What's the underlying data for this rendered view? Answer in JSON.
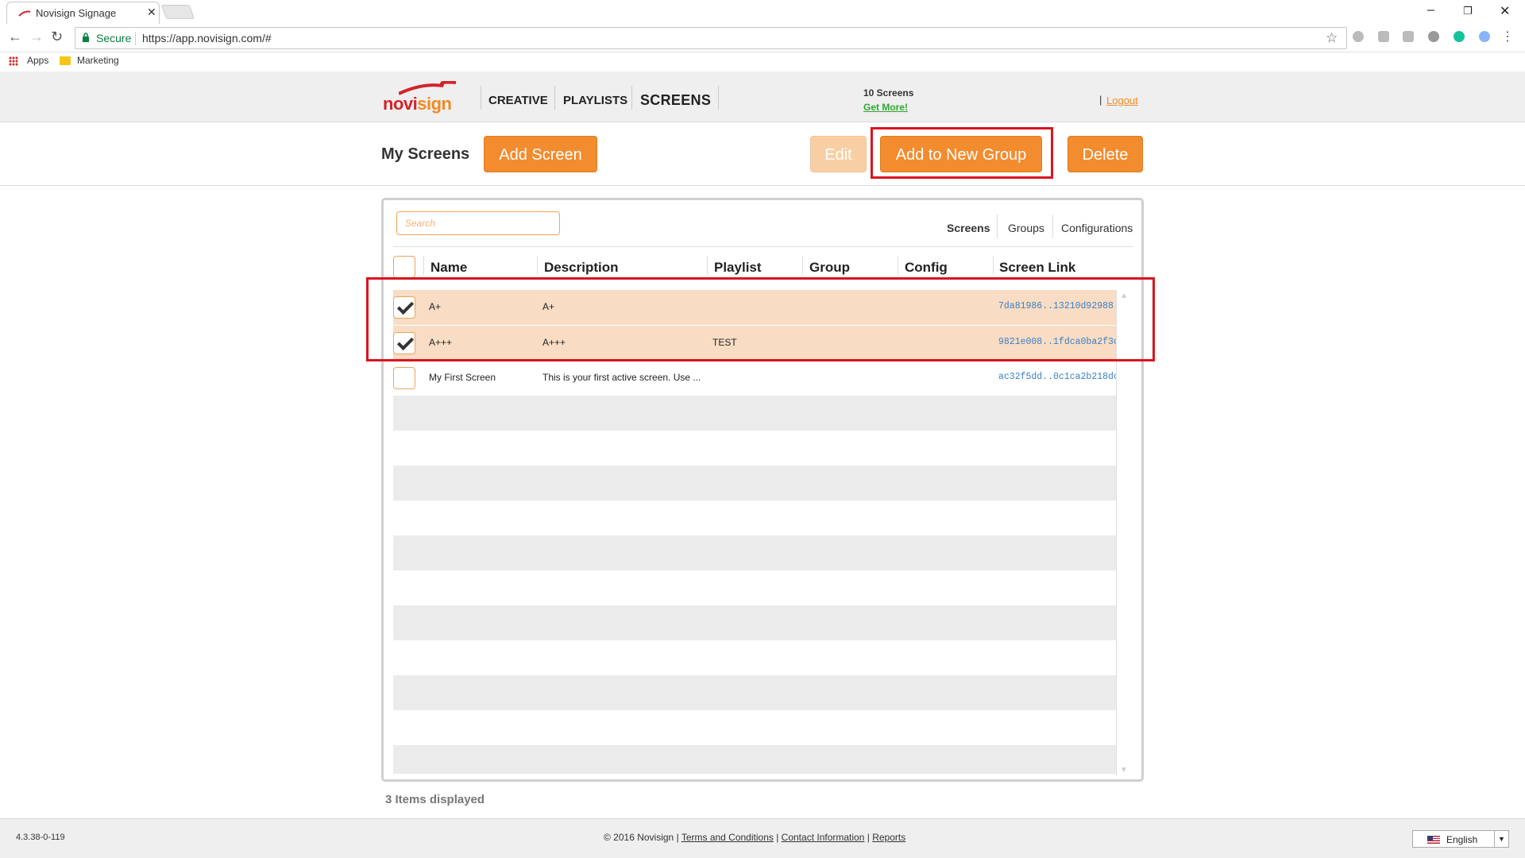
{
  "browser": {
    "tab_title": "Novisign Signage",
    "tab_close": "✕",
    "secure_label": "Secure",
    "url": "https://app.novisign.com/#",
    "bookmarks": [
      "Apps",
      "Marketing"
    ]
  },
  "header": {
    "logo_a": "novi",
    "logo_b": "sign",
    "nav": [
      "CREATIVE",
      "PLAYLISTS",
      "SCREENS"
    ],
    "screens_count": "10 Screens",
    "get_more": "Get More!",
    "logout_sep": "|",
    "logout": "Logout"
  },
  "toolbar": {
    "title": "My Screens",
    "add_screen": "Add Screen",
    "edit": "Edit",
    "add_group": "Add to New Group",
    "delete": "Delete"
  },
  "grid": {
    "search_placeholder": "Search",
    "view_tabs": [
      "Screens",
      "Groups",
      "Configurations"
    ],
    "columns": [
      "Name",
      "Description",
      "Playlist",
      "Group",
      "Config",
      "Screen Link"
    ],
    "rows": [
      {
        "name": "A+",
        "description": "A+",
        "playlist": "",
        "group": "",
        "config": "",
        "link": "7da81986..13210d92988",
        "checked": true
      },
      {
        "name": "A+++",
        "description": "A+++",
        "playlist": "TEST",
        "group": "",
        "config": "",
        "link": "9821e008..1fdca0ba2f3c",
        "checked": true
      },
      {
        "name": "My First Screen",
        "description": "This is your first active screen. Use ...",
        "playlist": "",
        "group": "",
        "config": "",
        "link": "ac32f5dd..0c1ca2b218dc",
        "checked": false
      }
    ],
    "items_displayed": "3 Items displayed"
  },
  "footer": {
    "version": "4.3.38-0-119",
    "copyright": "© 2016 Novisign",
    "terms": "Terms and Conditions",
    "contact": "Contact Information",
    "reports": "Reports",
    "language": "English"
  },
  "colors": {
    "accent": "#f28c2e",
    "highlight": "#d9141e",
    "selected_row": "#f8dcc3"
  }
}
